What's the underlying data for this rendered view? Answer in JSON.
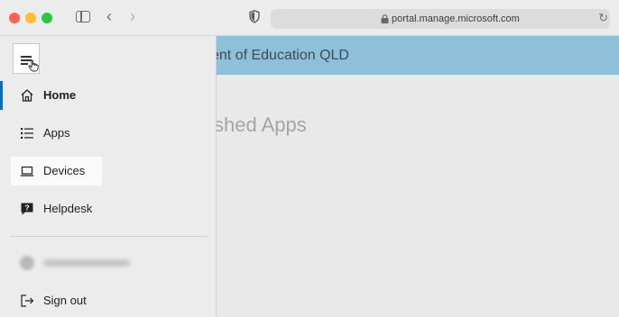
{
  "browser": {
    "url": "portal.manage.microsoft.com",
    "icons": [
      "sidebar-toggle-icon",
      "back-icon",
      "forward-icon",
      "shield-icon",
      "lock-icon",
      "reload-icon"
    ]
  },
  "page": {
    "banner_title": "ent of Education QLD",
    "heading": "shed Apps"
  },
  "drawer": {
    "menu_icon": "hamburger-icon",
    "items": [
      {
        "label": "Home",
        "icon": "home-icon",
        "active": true
      },
      {
        "label": "Apps",
        "icon": "apps-list-icon"
      },
      {
        "label": "Devices",
        "icon": "laptop-icon",
        "hovered": true
      },
      {
        "label": "Helpdesk",
        "icon": "helpdesk-icon"
      }
    ],
    "sign_out": {
      "label": "Sign out",
      "icon": "sign-out-icon"
    }
  },
  "colors": {
    "banner": "#8fc0d9",
    "accent": "#0f6cbd",
    "drawer_bg": "#ececec"
  }
}
